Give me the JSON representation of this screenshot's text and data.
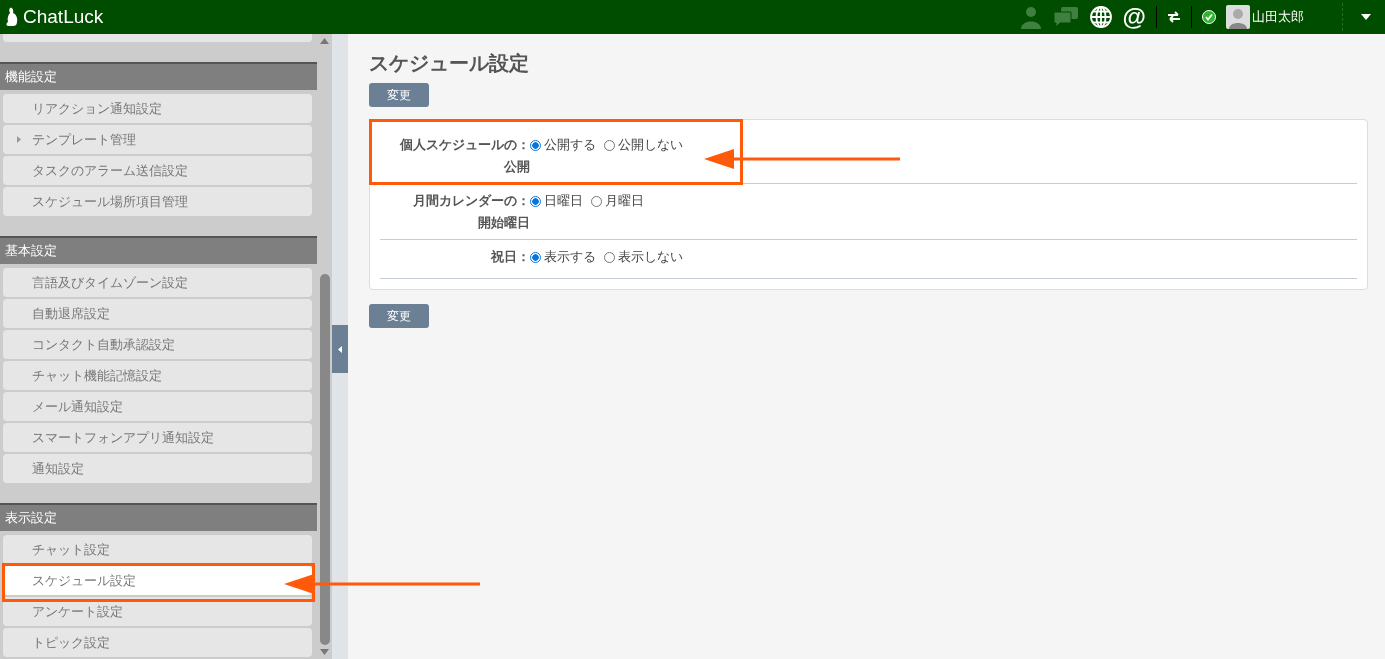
{
  "header": {
    "logo": "ChatLuck",
    "mention_icon": "@",
    "user_name": "山田太郎",
    "online": true
  },
  "sidebar": {
    "sections": [
      {
        "title": "機能設定",
        "items": [
          {
            "label": "リアクション通知設定",
            "selected": false,
            "expandable": false
          },
          {
            "label": "テンプレート管理",
            "selected": false,
            "expandable": true
          },
          {
            "label": "タスクのアラーム送信設定",
            "selected": false,
            "expandable": false
          },
          {
            "label": "スケジュール場所項目管理",
            "selected": false,
            "expandable": false
          }
        ]
      },
      {
        "title": "基本設定",
        "items": [
          {
            "label": "言語及びタイムゾーン設定",
            "selected": false,
            "expandable": false
          },
          {
            "label": "自動退席設定",
            "selected": false,
            "expandable": false
          },
          {
            "label": "コンタクト自動承認設定",
            "selected": false,
            "expandable": false
          },
          {
            "label": "チャット機能記憶設定",
            "selected": false,
            "expandable": false
          },
          {
            "label": "メール通知設定",
            "selected": false,
            "expandable": false
          },
          {
            "label": "スマートフォンアプリ通知設定",
            "selected": false,
            "expandable": false
          },
          {
            "label": "通知設定",
            "selected": false,
            "expandable": false
          }
        ]
      },
      {
        "title": "表示設定",
        "items": [
          {
            "label": "チャット設定",
            "selected": false,
            "expandable": false
          },
          {
            "label": "スケジュール設定",
            "selected": true,
            "expandable": false
          },
          {
            "label": "アンケート設定",
            "selected": false,
            "expandable": false
          },
          {
            "label": "トピック設定",
            "selected": false,
            "expandable": false
          }
        ]
      }
    ]
  },
  "page": {
    "title": "スケジュール設定",
    "top_button": "変更",
    "bottom_button": "変更",
    "settings": [
      {
        "label_lines": [
          "個人スケジュールの：",
          "公開"
        ],
        "options": [
          {
            "label": "公開する",
            "selected": true
          },
          {
            "label": "公開しない",
            "selected": false
          }
        ]
      },
      {
        "label_lines": [
          "月間カレンダーの：",
          "開始曜日"
        ],
        "options": [
          {
            "label": "日曜日",
            "selected": true
          },
          {
            "label": "月曜日",
            "selected": false
          }
        ]
      },
      {
        "label_lines": [
          "祝日："
        ],
        "options": [
          {
            "label": "表示する",
            "selected": true
          },
          {
            "label": "表示しない",
            "selected": false
          }
        ]
      }
    ]
  }
}
